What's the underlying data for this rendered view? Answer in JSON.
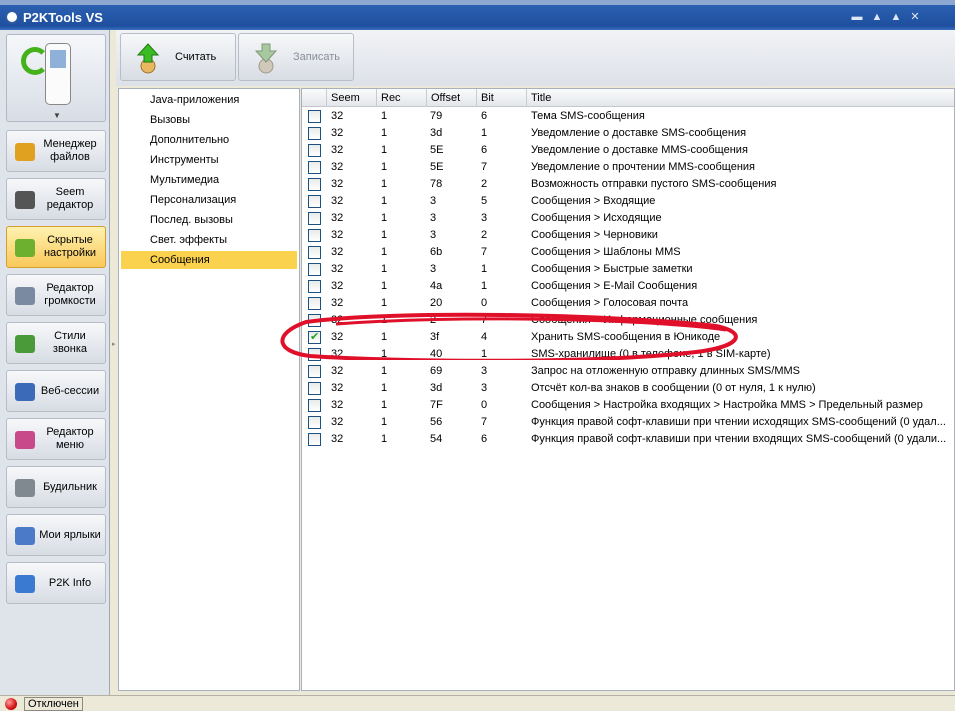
{
  "window": {
    "title": "P2KTools VS",
    "buttons": {
      "minimize": "▬",
      "restore": "▲",
      "close": "✕"
    }
  },
  "sidebar": {
    "items": [
      {
        "label": "Менеджер файлов",
        "icon": "file-manager-icon",
        "color": "#e0a020",
        "active": false
      },
      {
        "label": "Seem редактор",
        "icon": "seem-editor-icon",
        "color": "#555555",
        "active": false
      },
      {
        "label": "Скрытые настройки",
        "icon": "hidden-settings-icon",
        "color": "#6db030",
        "active": true
      },
      {
        "label": "Редактор громкости",
        "icon": "volume-editor-icon",
        "color": "#7a8aa0",
        "active": false
      },
      {
        "label": "Стили звонка",
        "icon": "ring-styles-icon",
        "color": "#4a9a3a",
        "active": false
      },
      {
        "label": "Веб-сессии",
        "icon": "web-sessions-icon",
        "color": "#3a6ab8",
        "active": false
      },
      {
        "label": "Редактор меню",
        "icon": "menu-editor-icon",
        "color": "#c84a8a",
        "active": false
      },
      {
        "label": "Будильник",
        "icon": "alarm-clock-icon",
        "color": "#808890",
        "active": false
      },
      {
        "label": "Мои ярлыки",
        "icon": "shortcuts-icon",
        "color": "#4a7ac8",
        "active": false
      },
      {
        "label": "P2K Info",
        "icon": "info-icon",
        "color": "#3a7ad0",
        "active": false
      }
    ]
  },
  "toolbar": {
    "read_label": "Считать",
    "write_label": "Записать",
    "write_disabled": true
  },
  "tree": {
    "items": [
      "Java-приложения",
      "Вызовы",
      "Дополнительно",
      "Инструменты",
      "Мультимедиа",
      "Персонализация",
      "Послед. вызовы",
      "Свет. эффекты",
      "Сообщения"
    ],
    "selected_index": 8
  },
  "grid": {
    "columns": [
      "Seem",
      "Rec",
      "Offset",
      "Bit",
      "Title"
    ],
    "rows": [
      {
        "checked": false,
        "seem": "32",
        "rec": "1",
        "offset": "79",
        "bit": "6",
        "title": "Тема SMS-сообщения"
      },
      {
        "checked": false,
        "seem": "32",
        "rec": "1",
        "offset": "3d",
        "bit": "1",
        "title": "Уведомление о доставке SMS-сообщения"
      },
      {
        "checked": false,
        "seem": "32",
        "rec": "1",
        "offset": "5E",
        "bit": "6",
        "title": "Уведомление о доставке MMS-сообщения"
      },
      {
        "checked": false,
        "seem": "32",
        "rec": "1",
        "offset": "5E",
        "bit": "7",
        "title": "Уведомление о прочтении MMS-сообщения"
      },
      {
        "checked": false,
        "seem": "32",
        "rec": "1",
        "offset": "78",
        "bit": "2",
        "title": "Возможность отправки пустого SMS-сообщения"
      },
      {
        "checked": false,
        "seem": "32",
        "rec": "1",
        "offset": "3",
        "bit": "5",
        "title": "Сообщения > Входящие"
      },
      {
        "checked": false,
        "seem": "32",
        "rec": "1",
        "offset": "3",
        "bit": "3",
        "title": "Сообщения > Исходящие"
      },
      {
        "checked": false,
        "seem": "32",
        "rec": "1",
        "offset": "3",
        "bit": "2",
        "title": "Сообщения > Черновики"
      },
      {
        "checked": false,
        "seem": "32",
        "rec": "1",
        "offset": "6b",
        "bit": "7",
        "title": "Сообщения > Шаблоны MMS"
      },
      {
        "checked": false,
        "seem": "32",
        "rec": "1",
        "offset": "3",
        "bit": "1",
        "title": "Сообщения > Быстрые заметки"
      },
      {
        "checked": false,
        "seem": "32",
        "rec": "1",
        "offset": "4a",
        "bit": "1",
        "title": "Сообщения > E-Mail Сообщения"
      },
      {
        "checked": false,
        "seem": "32",
        "rec": "1",
        "offset": "20",
        "bit": "0",
        "title": "Сообщения > Голосовая почта"
      },
      {
        "checked": false,
        "seem": "32",
        "rec": "1",
        "offset": "2",
        "bit": "7",
        "title": "Сообщения > Информационные сообщения"
      },
      {
        "checked": true,
        "seem": "32",
        "rec": "1",
        "offset": "3f",
        "bit": "4",
        "title": "Хранить SMS-сообщения в Юникоде"
      },
      {
        "checked": false,
        "seem": "32",
        "rec": "1",
        "offset": "40",
        "bit": "1",
        "title": "SMS-хранилище (0 в телефоне, 1 в SIM-карте)"
      },
      {
        "checked": false,
        "seem": "32",
        "rec": "1",
        "offset": "69",
        "bit": "3",
        "title": "Запрос на отложенную отправку длинных SMS/MMS"
      },
      {
        "checked": false,
        "seem": "32",
        "rec": "1",
        "offset": "3d",
        "bit": "3",
        "title": "Отсчёт кол-ва знаков в сообщении (0 от нуля, 1 к нулю)"
      },
      {
        "checked": false,
        "seem": "32",
        "rec": "1",
        "offset": "7F",
        "bit": "0",
        "title": "Сообщения > Настройка входящих > Настройка MMS > Предельный размер"
      },
      {
        "checked": false,
        "seem": "32",
        "rec": "1",
        "offset": "56",
        "bit": "7",
        "title": "Функция правой софт-клавиши при чтении исходящих SMS-сообщений (0 удал..."
      },
      {
        "checked": false,
        "seem": "32",
        "rec": "1",
        "offset": "54",
        "bit": "6",
        "title": "Функция правой софт-клавиши при чтении входящих SMS-сообщений (0 удали..."
      }
    ]
  },
  "status": {
    "text": "Отключен",
    "led_color": "#d41414"
  },
  "colors": {
    "title_bar": "#1f4f9f",
    "selection": "#fbd24e",
    "annotation": "#e0102a"
  }
}
